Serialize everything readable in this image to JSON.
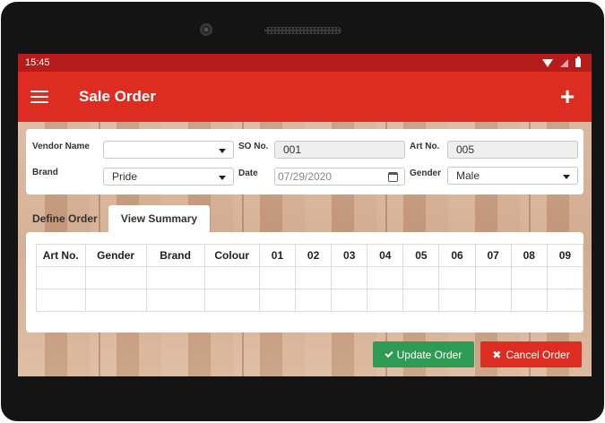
{
  "status_bar": {
    "time": "15:45"
  },
  "app_bar": {
    "title": "Sale Order",
    "add_label": "+"
  },
  "form": {
    "vendor_name": {
      "label": "Vendor Name",
      "value": ""
    },
    "so_no": {
      "label": "SO No.",
      "value": "001"
    },
    "art_no": {
      "label": "Art No.",
      "value": "005"
    },
    "brand": {
      "label": "Brand",
      "value": "Pride"
    },
    "date": {
      "label": "Date",
      "value": "07/29/2020"
    },
    "gender": {
      "label": "Gender",
      "value": "Male"
    }
  },
  "tabs": [
    {
      "label": "Define Order",
      "active": false
    },
    {
      "label": "View Summary",
      "active": true
    }
  ],
  "table": {
    "columns": [
      "Art No.",
      "Gender",
      "Brand",
      "Colour",
      "01",
      "02",
      "03",
      "04",
      "05",
      "06",
      "07",
      "08",
      "09"
    ],
    "rows": 2
  },
  "buttons": {
    "update": "Update Order",
    "cancel": "Cancel Order"
  },
  "colors": {
    "primary": "#dd2c21",
    "status_bar": "#b71c1c",
    "success": "#2e9b55"
  },
  "icons": [
    "menu-icon",
    "plus-icon",
    "calendar-icon",
    "check-icon",
    "close-icon",
    "wifi-icon",
    "signal-icon",
    "battery-icon"
  ]
}
